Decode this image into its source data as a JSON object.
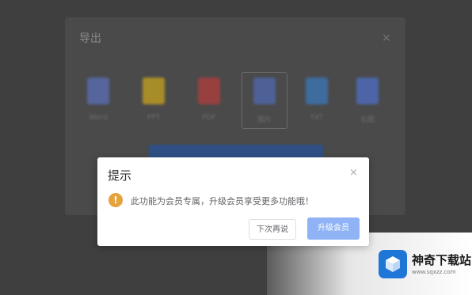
{
  "background_panel": {
    "title": "导出",
    "close_glyph": "×",
    "formats": [
      {
        "label": "Word",
        "icon": "word-file-icon",
        "color": "#5a6fb8"
      },
      {
        "label": "PPT",
        "icon": "ppt-file-icon",
        "color": "#c9a320"
      },
      {
        "label": "PDF",
        "icon": "pdf-file-icon",
        "color": "#b33c3c"
      },
      {
        "label": "图片",
        "icon": "image-file-icon",
        "color": "#5069b0"
      },
      {
        "label": "TXT",
        "icon": "txt-file-icon",
        "color": "#3a78bc"
      },
      {
        "label": "长图",
        "icon": "long-image-icon",
        "color": "#4e6fc7"
      }
    ]
  },
  "dialog": {
    "title": "提示",
    "close_glyph": "×",
    "warning_glyph": "!",
    "message": "此功能为会员专属，升级会员享受更多功能哦！",
    "secondary_button": "下次再说",
    "primary_button": "升级会员",
    "accent_color": "#e6a23c",
    "primary_color": "#8fb3f5"
  },
  "watermark": {
    "name": "神奇下载站",
    "url": "www.sqxzz.com"
  }
}
